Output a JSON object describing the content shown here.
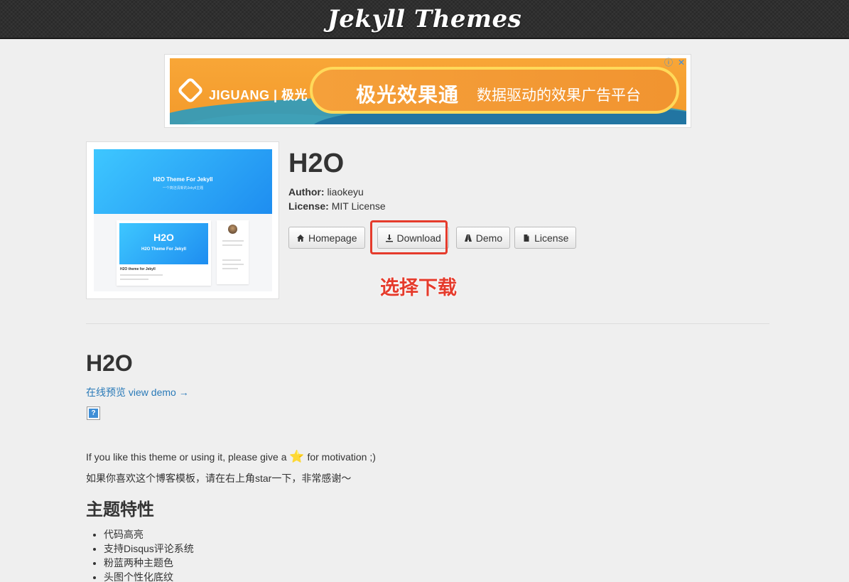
{
  "header": {
    "site_title": "Jekyll Themes"
  },
  "ad": {
    "brand": "JIGUANG | 极光",
    "headline": "极光效果通",
    "tagline": "数据驱动的效果广告平台",
    "info_icon": "info-icon",
    "close_icon": "close-icon"
  },
  "thumbnail": {
    "hero_title": "H2O Theme For Jekyll",
    "hero_sub": "一个简洁清新的Jekyll主题",
    "card_logo": "H2O",
    "card_tagline": "H2O Theme For Jekyll",
    "card_title": "H2O theme for Jekyll"
  },
  "theme": {
    "name": "H2O",
    "author_label": "Author:",
    "author": "liaokeyu",
    "license_label": "License:",
    "license": "MIT License"
  },
  "buttons": {
    "homepage": "Homepage",
    "download": "Download",
    "demo": "Demo",
    "license": "License"
  },
  "annotation": "选择下载",
  "readme": {
    "title": "H2O",
    "demo_link": "在线预览 view demo →",
    "broken_image": "?",
    "like_text_before": "If you like this theme or using it, please give a",
    "like_text_after": "for motivation ;)",
    "star": "⭐",
    "thanks_text": "如果你喜欢这个博客模板，请在右上角star一下，非常感谢～",
    "features_title": "主题特性",
    "features": [
      "代码高亮",
      "支持Disqus评论系统",
      "粉蓝两种主题色",
      "头图个性化底纹"
    ]
  },
  "colors": {
    "accent_red": "#e53b2c",
    "link": "#2a7ab8",
    "ad_orange": "#f8a637"
  }
}
